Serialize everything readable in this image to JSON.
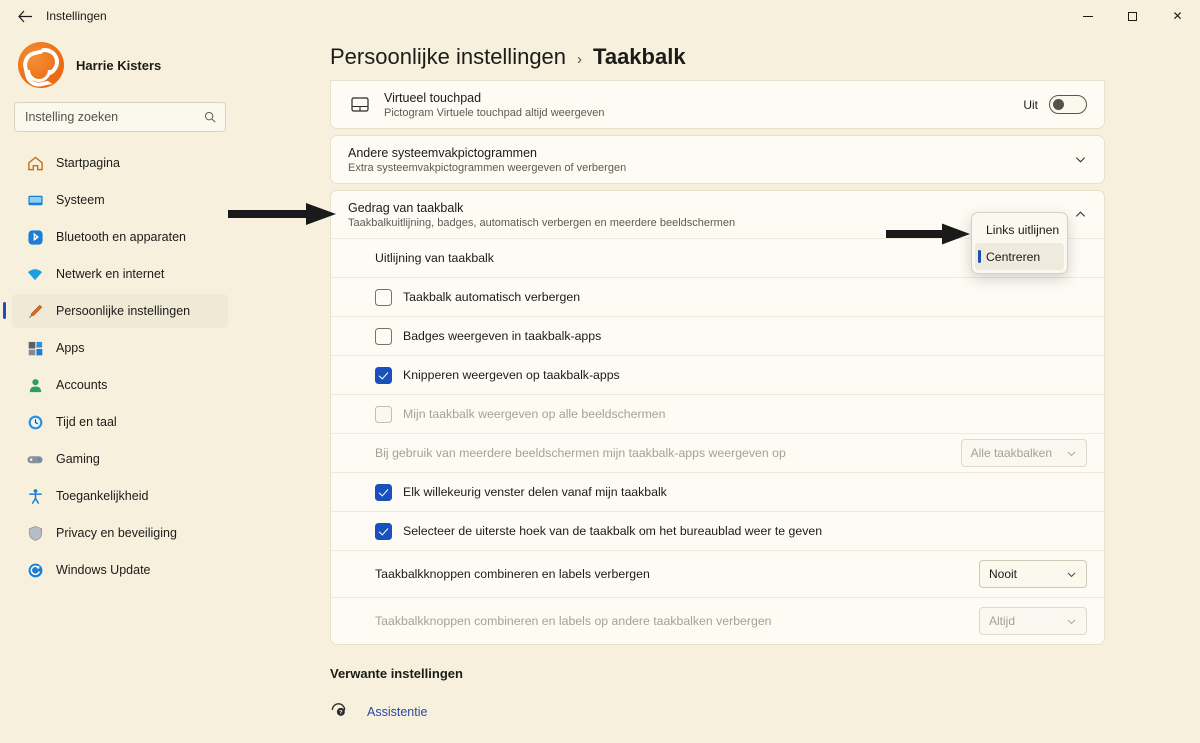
{
  "window": {
    "app_title": "Instellingen",
    "back_icon": "back-arrow-icon",
    "minimize_label": "minimize",
    "maximize_label": "maximize",
    "close_label": "✕"
  },
  "sidebar": {
    "profile": {
      "name": "Harrie Kisters",
      "avatar_icon": "user-avatar"
    },
    "search": {
      "placeholder": "Instelling zoeken",
      "value": "",
      "icon": "search-icon"
    },
    "items": [
      {
        "label": "Startpagina",
        "icon": "home-icon",
        "active": false
      },
      {
        "label": "Systeem",
        "icon": "monitor-icon",
        "active": false
      },
      {
        "label": "Bluetooth en apparaten",
        "icon": "bluetooth-icon",
        "active": false
      },
      {
        "label": "Netwerk en internet",
        "icon": "wifi-icon",
        "active": false
      },
      {
        "label": "Persoonlijke instellingen",
        "icon": "paintbrush-icon",
        "active": true
      },
      {
        "label": "Apps",
        "icon": "apps-icon",
        "active": false
      },
      {
        "label": "Accounts",
        "icon": "person-icon",
        "active": false
      },
      {
        "label": "Tijd en taal",
        "icon": "clock-icon",
        "active": false
      },
      {
        "label": "Gaming",
        "icon": "gamepad-icon",
        "active": false
      },
      {
        "label": "Toegankelijkheid",
        "icon": "accessibility-icon",
        "active": false
      },
      {
        "label": "Privacy en beveiliging",
        "icon": "shield-icon",
        "active": false
      },
      {
        "label": "Windows Update",
        "icon": "update-icon",
        "active": false
      }
    ]
  },
  "breadcrumb": {
    "parent": "Persoonlijke instellingen",
    "separator": "›",
    "current": "Taakbalk"
  },
  "settings": {
    "virtual_touchpad": {
      "title": "Virtueel touchpad",
      "subtitle": "Pictogram Virtuele touchpad altijd weergeven",
      "icon": "touchpad-icon",
      "state_label": "Uit"
    },
    "other_tray_icons": {
      "title": "Andere systeemvakpictogrammen",
      "subtitle": "Extra systeemvakpictogrammen weergeven of verbergen",
      "chevron": "chevron-down-icon"
    },
    "taskbar_behaviour": {
      "title": "Gedrag van taakbalk",
      "subtitle": "Taakbalkuitlijning, badges, automatisch verbergen en meerdere beeldschermen",
      "chevron": "chevron-up-icon",
      "rows": [
        {
          "type": "combo",
          "label": "Uitlijning van taakbalk",
          "value": "",
          "disabled": false
        },
        {
          "type": "checkbox",
          "label": "Taakbalk automatisch verbergen",
          "checked": false,
          "disabled": false
        },
        {
          "type": "checkbox",
          "label": "Badges weergeven in taakbalk-apps",
          "checked": false,
          "disabled": false
        },
        {
          "type": "checkbox",
          "label": "Knipperen weergeven op taakbalk-apps",
          "checked": true,
          "disabled": false
        },
        {
          "type": "checkbox",
          "label": "Mijn taakbalk weergeven op alle beeldschermen",
          "checked": false,
          "disabled": true
        },
        {
          "type": "combo",
          "label": "Bij gebruik van meerdere beeldschermen mijn taakbalk-apps weergeven op",
          "value": "Alle taakbalken",
          "disabled": true
        },
        {
          "type": "checkbox",
          "label": "Elk willekeurig venster delen vanaf mijn taakbalk",
          "checked": true,
          "disabled": false
        },
        {
          "type": "checkbox",
          "label": "Selecteer de uiterste hoek van de taakbalk om het bureaublad weer te geven",
          "checked": true,
          "disabled": false
        },
        {
          "type": "combo",
          "label": "Taakbalkknoppen combineren en labels verbergen",
          "value": "Nooit",
          "disabled": false
        },
        {
          "type": "combo",
          "label": "Taakbalkknoppen combineren en labels op andere taakbalken verbergen",
          "value": "Altijd",
          "disabled": true
        }
      ]
    }
  },
  "alignment_flyout": {
    "items": [
      {
        "label": "Links uitlijnen",
        "selected": false
      },
      {
        "label": "Centreren",
        "selected": true
      }
    ]
  },
  "related": {
    "heading": "Verwante instellingen",
    "link_label": "Assistentie",
    "link_icon": "help-support-icon"
  },
  "annotations": {
    "arrow_behaviour": "arrow-pointing-to-taskbar-behaviour",
    "arrow_flyout": "arrow-pointing-to-alignment-menu"
  },
  "colors": {
    "accent": "#1850bd",
    "page_bg": "#f7f0dd",
    "card_bg": "#fdfbf3",
    "link": "#2c4a9a"
  }
}
